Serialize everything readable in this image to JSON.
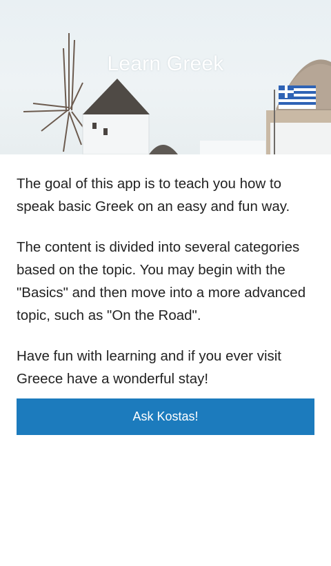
{
  "header": {
    "title": "Learn Greek",
    "image_description_icon": "santorini-windmill-icon",
    "flag_icon": "greek-flag-icon"
  },
  "content": {
    "paragraphs": [
      "The goal of this app is to teach you how to speak basic Greek on an easy and fun way.",
      "The content is divided into several categories based on the topic. You may begin with the \"Basics\" and then move into a more advanced topic, such as \"On the Road\".",
      "Have fun with learning and if you ever visit Greece have a wonderful stay!"
    ]
  },
  "actions": {
    "ask_label": "Ask Kostas!"
  },
  "colors": {
    "accent": "#1c7bbd",
    "text": "#222222",
    "background": "#ffffff"
  }
}
